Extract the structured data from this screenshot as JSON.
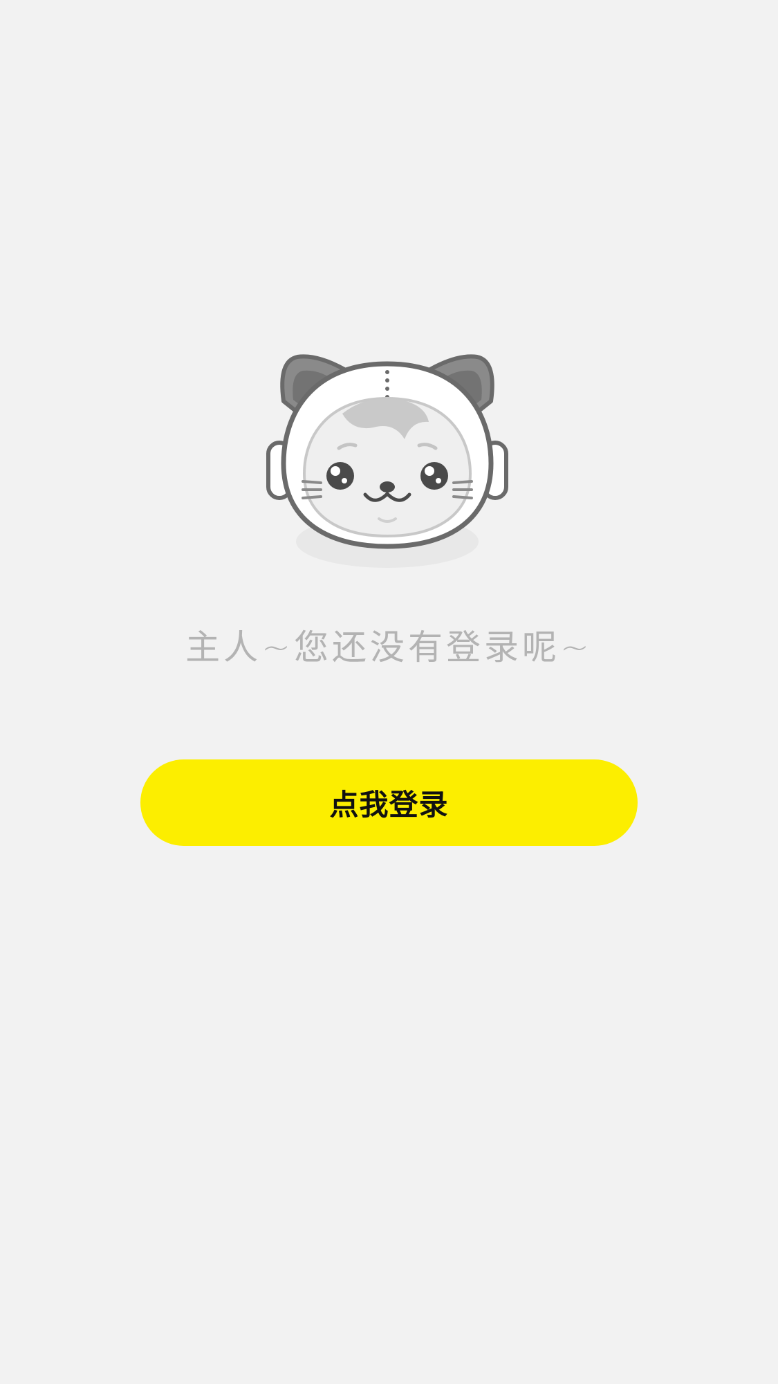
{
  "empty_state": {
    "message": "主人~您还没有登录呢~",
    "mascot_icon": "astronaut-cat-icon"
  },
  "login": {
    "button_label": "点我登录"
  },
  "colors": {
    "background": "#f2f2f2",
    "button_accent": "#fcee00",
    "message_text": "#b3b3b3"
  }
}
